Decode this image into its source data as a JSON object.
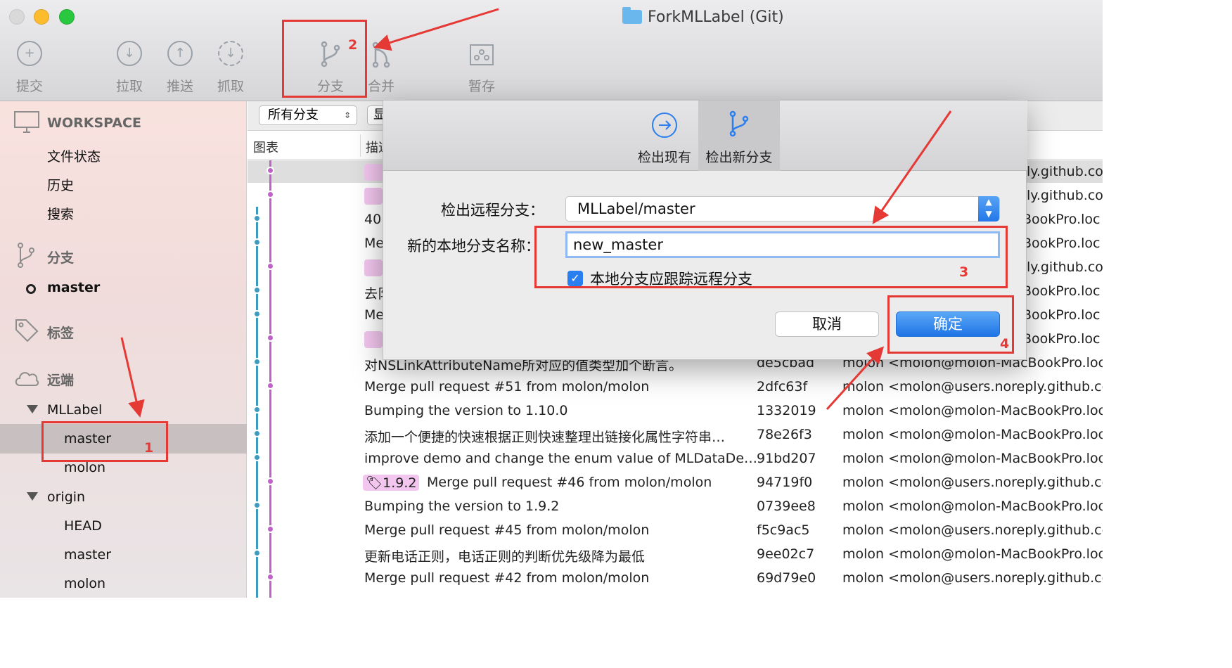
{
  "window": {
    "title": "ForkMLLabel (Git)"
  },
  "toolbar": {
    "commit": "提交",
    "pull": "拉取",
    "push": "推送",
    "fetch": "抓取",
    "branch": "分支",
    "merge": "合并",
    "stash": "暂存"
  },
  "sidebar": {
    "workspace": "WORKSPACE",
    "file_status": "文件状态",
    "history": "历史",
    "search": "搜索",
    "branches": "分支",
    "current_branch": "master",
    "tags": "标签",
    "remotes": "远端",
    "remote1": {
      "name": "MLLabel",
      "items": [
        "master",
        "molon"
      ]
    },
    "remote2": {
      "name": "origin",
      "items": [
        "HEAD",
        "master",
        "molon"
      ]
    }
  },
  "filter": {
    "all_branches": "所有分支",
    "show": "显"
  },
  "columns": {
    "graph": "图表",
    "description": "描述"
  },
  "rows_partial": [
    {
      "desc": "",
      "author": "ly.github.co"
    },
    {
      "desc": "",
      "author": "ly.github.co"
    },
    {
      "desc": "40",
      "author": "BookPro.loc"
    },
    {
      "desc": "Me",
      "author": "BookPro.loc"
    },
    {
      "desc": "",
      "author": "ly.github.co"
    },
    {
      "desc": "去阝",
      "author": "BookPro.loc"
    },
    {
      "desc": "Me",
      "author": "BookPro.loc"
    },
    {
      "desc": "",
      "author": "BookPro.loc"
    }
  ],
  "rows": [
    {
      "desc": "对NSLinkAttributeName所对应的值类型加个断言。",
      "hash": "de5cbad",
      "author": "molon <molon@molon-MacBookPro.loc"
    },
    {
      "desc": "Merge pull request #51 from molon/molon",
      "hash": "2dfc63f",
      "author": "molon <molon@users.noreply.github.co"
    },
    {
      "desc": "Bumping the version to 1.10.0",
      "hash": "1332019",
      "author": "molon <molon@molon-MacBookPro.loc"
    },
    {
      "desc": "添加一个便捷的快速根据正则快速整理出链接化属性字符串…",
      "hash": "78e26f3",
      "author": "molon <molon@molon-MacBookPro.loc"
    },
    {
      "desc": "improve demo and change the enum value of MLDataDe…",
      "hash": "91bd207",
      "author": "molon <molon@molon-MacBookPro.loc"
    },
    {
      "desc": "Merge pull request #46 from molon/molon",
      "tag": "1.9.2",
      "hash": "94719f0",
      "author": "molon <molon@users.noreply.github.co"
    },
    {
      "desc": "Bumping the version to 1.9.2",
      "hash": "0739ee8",
      "author": "molon <molon@molon-MacBookPro.loc"
    },
    {
      "desc": "Merge pull request #45 from molon/molon",
      "hash": "f5c9ac5",
      "author": "molon <molon@users.noreply.github.co"
    },
    {
      "desc": "更新电话正则，电话正则的判断优先级降为最低",
      "hash": "9ee02c7",
      "author": "molon <molon@molon-MacBookPro.loc"
    },
    {
      "desc": "Merge pull request #42 from molon/molon",
      "hash": "69d79e0",
      "author": "molon <molon@users.noreply.github.co"
    }
  ],
  "dialog": {
    "tab_checkout_existing": "检出现有",
    "tab_checkout_new": "检出新分支",
    "remote_branch_label": "检出远程分支：",
    "remote_branch_value": "MLLabel/master",
    "local_name_label": "新的本地分支名称：",
    "local_name_value": "new_master",
    "track_label": "本地分支应跟踪远程分支",
    "cancel": "取消",
    "ok": "确定"
  },
  "annotations": {
    "n1": "1",
    "n2": "2",
    "n3": "3",
    "n4": "4"
  },
  "colors": {
    "accent": "#2a7ff0",
    "annotation": "#e53935",
    "lane_purple": "#c062c8",
    "lane_teal": "#3d9bbf"
  }
}
